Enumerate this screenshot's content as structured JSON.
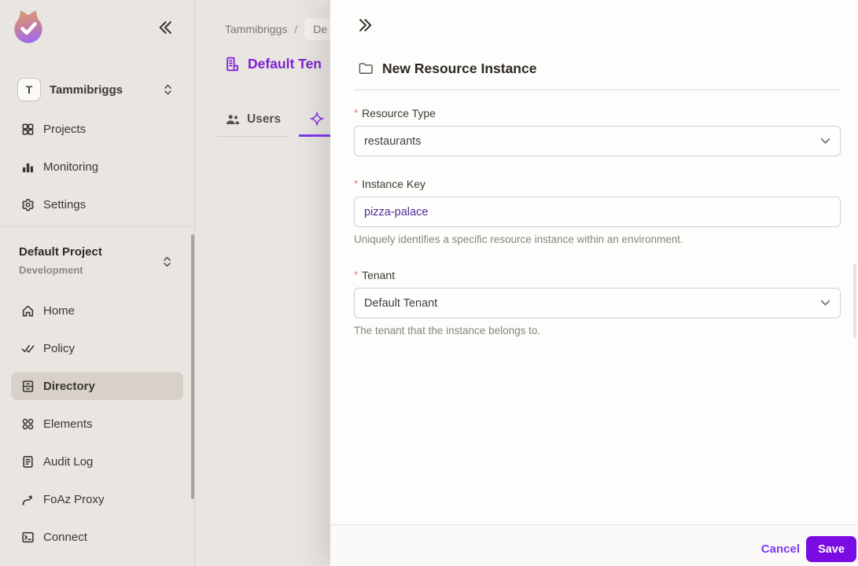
{
  "colors": {
    "accent_purple": "#7c3aed",
    "title_purple": "#7d1fd3",
    "save_button_bg": "#7a0be2",
    "required_asterisk": "#e4716c",
    "sidebar_bg": "#e9e6e2",
    "drawer_bg": "#fdfdfc",
    "active_item_bg": "#d7d1ca"
  },
  "sidebar": {
    "logo_icon": "permit-cat-logo",
    "collapse_icon": "chevrons-left-icon",
    "workspace": {
      "avatar_letter": "T",
      "name": "Tammibriggs"
    },
    "top_items": [
      {
        "label": "Projects",
        "icon": "grid-squares-icon"
      },
      {
        "label": "Monitoring",
        "icon": "bar-chart-icon"
      },
      {
        "label": "Settings",
        "icon": "gear-icon"
      }
    ],
    "project_switcher": {
      "project": "Default Project",
      "environment": "Development"
    },
    "nav_items": [
      {
        "label": "Home",
        "icon": "home-icon",
        "active": false
      },
      {
        "label": "Policy",
        "icon": "double-check-icon",
        "active": false
      },
      {
        "label": "Directory",
        "icon": "cabinet-icon",
        "active": true
      },
      {
        "label": "Elements",
        "icon": "circles-grid-icon",
        "active": false
      },
      {
        "label": "Audit Log",
        "icon": "document-icon",
        "active": false
      },
      {
        "label": "FoAz Proxy",
        "icon": "curve-arrow-icon",
        "active": false
      },
      {
        "label": "Connect",
        "icon": "terminal-icon",
        "active": false
      }
    ]
  },
  "main": {
    "breadcrumb": [
      "Tammibriggs",
      "De"
    ],
    "breadcrumb_separator": "/",
    "page_title": "Default Ten",
    "title_icon": "tenant-building-icon",
    "tabs": [
      {
        "label": "Users",
        "icon": "users-icon",
        "active": false
      },
      {
        "label": "",
        "icon": "sparkle-icon",
        "active": true
      }
    ]
  },
  "drawer": {
    "collapse_icon": "chevrons-right-icon",
    "title_icon": "folder-icon",
    "title": "New Resource Instance",
    "required_marker": "*",
    "resource_type": {
      "label": "Resource Type",
      "value": "restaurants"
    },
    "instance_key": {
      "label": "Instance Key",
      "value": "pizza-palace",
      "helper": "Uniquely identifies a specific resource instance within an environment."
    },
    "tenant": {
      "label": "Tenant",
      "value": "Default Tenant",
      "helper": "The tenant that the instance belongs to."
    },
    "footer": {
      "cancel_label": "Cancel",
      "save_label": "Save"
    }
  }
}
